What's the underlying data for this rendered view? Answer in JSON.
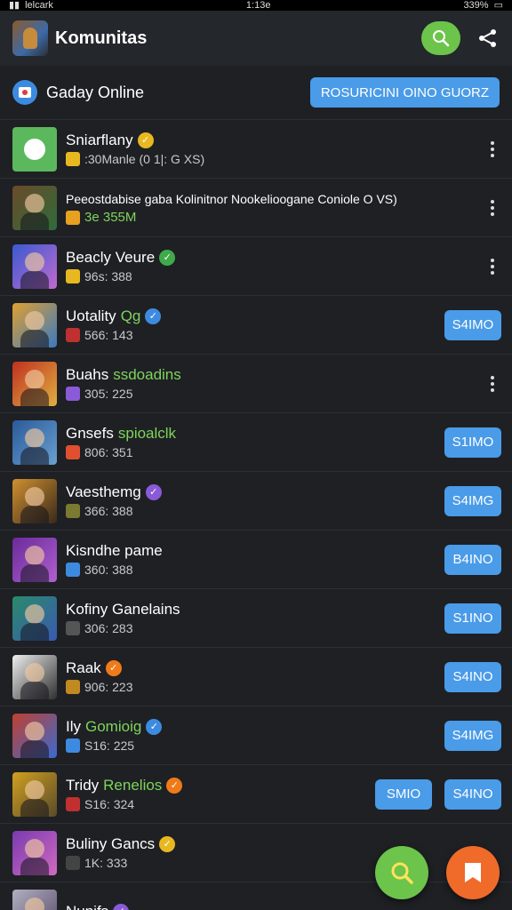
{
  "status_bar": {
    "carrier": "lelcark",
    "time": "1:13e",
    "battery": "339%"
  },
  "header": {
    "title": "Komunitas"
  },
  "online": {
    "title": "Gaday Online",
    "button_label": "ROSURICINI OINO GUORZ"
  },
  "colors": {
    "accent_blue": "#4a9be8",
    "accent_green": "#6cc44a",
    "accent_orange": "#f06a2a",
    "background": "#1e2024"
  },
  "rows": [
    {
      "name": "Sniarflany",
      "name_extra": "",
      "sub": ":30Manle (0 1|: G XS)",
      "badge": "gold",
      "action": "menu",
      "buttons": []
    },
    {
      "name": "Peeostdabise gaba Kolinitnor Nookelioogane Coniole O VS)",
      "name_extra": "",
      "sub": "3e 355M",
      "badge": "",
      "action": "menu",
      "buttons": []
    },
    {
      "name": "Beacly Veure",
      "name_extra": "",
      "sub": "96s: 388",
      "badge": "green",
      "action": "menu",
      "buttons": []
    },
    {
      "name": "Uotality",
      "name_extra": "Qg",
      "sub": "566: 143",
      "badge": "blue",
      "action": "button",
      "buttons": [
        "S4IMO"
      ]
    },
    {
      "name": "Buahs",
      "name_extra": "ssdoadins",
      "sub": "305: 225",
      "badge": "",
      "action": "menu",
      "buttons": []
    },
    {
      "name": "Gnsefs",
      "name_extra": "spioalclk",
      "sub": "806: 351",
      "badge": "",
      "action": "button",
      "buttons": [
        "S1IMO"
      ]
    },
    {
      "name": "Vaesthemg",
      "name_extra": "",
      "sub": "366: 388",
      "badge": "purple",
      "action": "button",
      "buttons": [
        "S4IMG"
      ]
    },
    {
      "name": "Kisndhe pame",
      "name_extra": "",
      "sub": "360: 388",
      "badge": "",
      "action": "button",
      "buttons": [
        "B4INO"
      ]
    },
    {
      "name": "Kofiny Ganelains",
      "name_extra": "",
      "sub": "306: 283",
      "badge": "",
      "action": "button",
      "buttons": [
        "S1INO"
      ]
    },
    {
      "name": "Raak",
      "name_extra": "",
      "sub": "906: 223",
      "badge": "orange-green",
      "action": "button",
      "buttons": [
        "S4INO"
      ]
    },
    {
      "name": "Ily",
      "name_extra": "Gomioig",
      "sub": "S16: 225",
      "badge": "blue",
      "action": "button",
      "buttons": [
        "S4IMG"
      ]
    },
    {
      "name": "Tridy",
      "name_extra": "Renelios",
      "sub": "S16: 324",
      "badge": "orange",
      "action": "button",
      "buttons": [
        "SMIO",
        "S4INO"
      ]
    },
    {
      "name": "Buliny Gancs",
      "name_extra": "",
      "sub": "1K: 333",
      "badge": "gold",
      "action": "none",
      "buttons": []
    },
    {
      "name": "Nunifs",
      "name_extra": "",
      "sub": "",
      "badge": "purple",
      "action": "none",
      "buttons": []
    }
  ]
}
